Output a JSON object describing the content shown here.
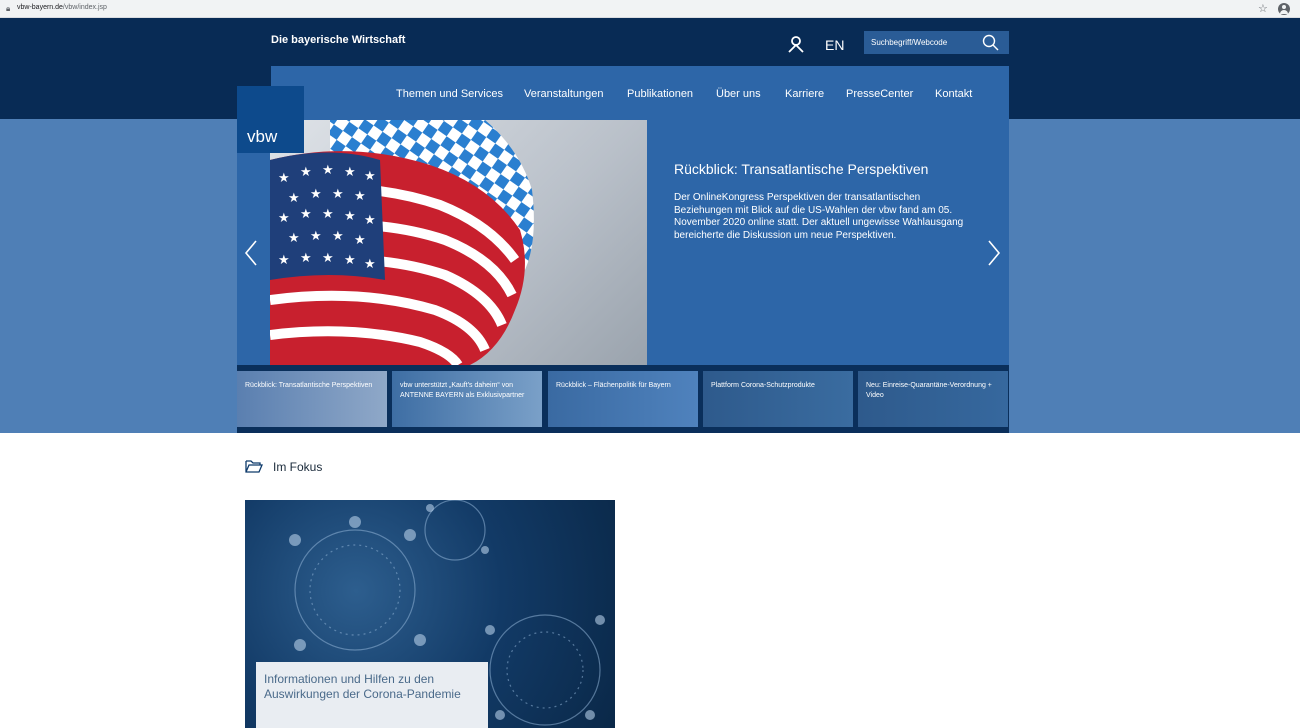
{
  "browser": {
    "url_host": "vbw-bayern.de",
    "url_path": "/vbw/index.jsp"
  },
  "header": {
    "brand": "Die bayerische Wirtschaft",
    "lang": "EN",
    "search_placeholder": "Suchbegriff/Webcode",
    "logo": "vbw"
  },
  "nav": {
    "items": [
      {
        "label": "Themen und Services"
      },
      {
        "label": "Veranstaltungen"
      },
      {
        "label": "Publikationen"
      },
      {
        "label": "Über uns"
      },
      {
        "label": "Karriere"
      },
      {
        "label": "PresseCenter"
      },
      {
        "label": "Kontakt"
      }
    ]
  },
  "hero": {
    "title": "Rückblick: Transatlantische Perspektiven",
    "text": "Der OnlineKongress Perspektiven der transatlantischen Beziehungen mit Blick auf die US-Wahlen der vbw fand am 05. November 2020 online statt. Der aktuell ungewisse Wahlausgang bereicherte die Diskussion um neue Perspektiven."
  },
  "thumbs": [
    {
      "label": "Rückblick: Transatlantische Perspektiven"
    },
    {
      "label": "vbw unterstützt „Kauft's daheim“ von ANTENNE BAYERN als Exklusivpartner"
    },
    {
      "label": "Rückblick – Flächenpolitik für Bayern"
    },
    {
      "label": "Plattform Corona-Schutzprodukte"
    },
    {
      "label": "Neu: Einreise-Quarantäne-Verordnung + Video"
    }
  ],
  "fokus": {
    "title": "Im Fokus",
    "card_label": "Informationen und Hilfen zu den Auswirkungen der Corona-Pandemie"
  },
  "colors": {
    "dark_navy": "#082b55",
    "nav_blue": "#2d66a8",
    "band_blue": "#4f7fb6",
    "active_accent": "#e8a01e"
  }
}
